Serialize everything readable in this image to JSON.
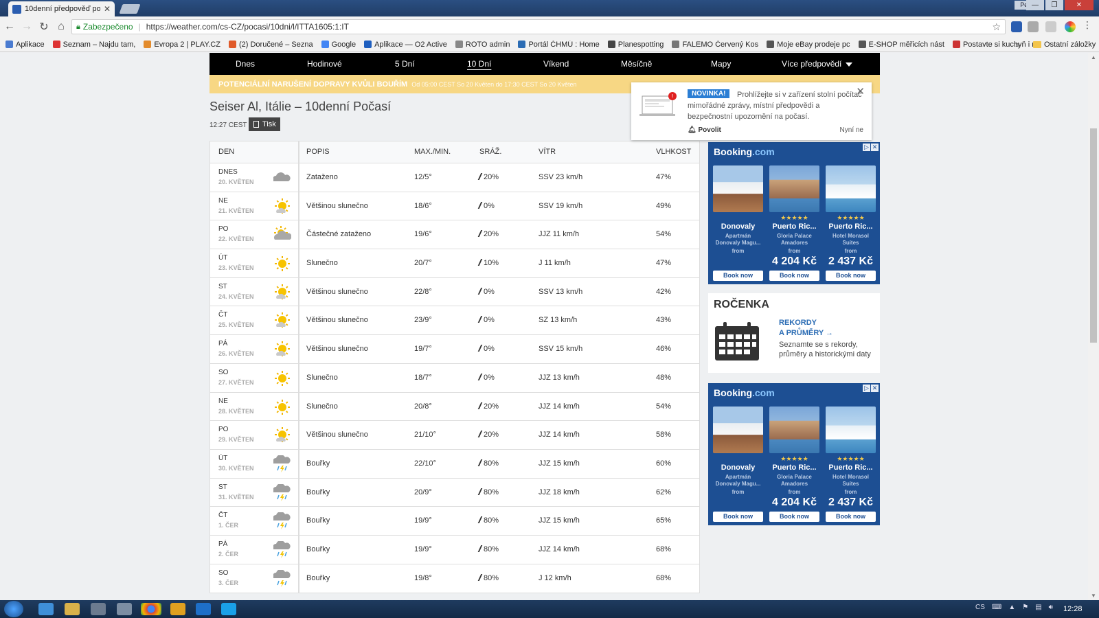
{
  "browser": {
    "tab_title": "10denní předpověď poč",
    "secure_label": "Zabezpečeno",
    "url": "https://weather.com/cs-CZ/pocasi/10dni/l/ITTA1605:1:IT",
    "user_label": "Petr",
    "bookmarks": [
      {
        "label": "Aplikace",
        "color": "#4a7bd0"
      },
      {
        "label": "Seznam – Najdu tam,",
        "color": "#d33"
      },
      {
        "label": "Evropa 2 | PLAY.CZ",
        "color": "#e38b2c"
      },
      {
        "label": "(2) Doručené – Sezna",
        "color": "#e05a2a"
      },
      {
        "label": "Google",
        "color": "#4285f4"
      },
      {
        "label": "Aplikace — O2 Active",
        "color": "#1f5fbf"
      },
      {
        "label": "ROTO admin",
        "color": "#888"
      },
      {
        "label": "Portál ČHMÚ : Home",
        "color": "#2b6cb4"
      },
      {
        "label": "Planespotting",
        "color": "#444"
      },
      {
        "label": "FALEMO Červený Kos",
        "color": "#777"
      },
      {
        "label": "Moje eBay prodeje pc",
        "color": "#555"
      },
      {
        "label": "E-SHOP měřicích nást",
        "color": "#555"
      },
      {
        "label": "Postavte si kuchyň i n",
        "color": "#c33"
      }
    ],
    "bookmarks_more": "»",
    "other_bookmarks": "Ostatní záložky"
  },
  "nav": {
    "items": [
      "Dnes",
      "Hodinové",
      "5 Dní",
      "10 Dní",
      "Víkend",
      "Měsíčně",
      "Mapy",
      "Více předpovědí"
    ]
  },
  "alert": {
    "title": "POTENCIÁLNÍ NARUŠENÍ DOPRAVY KVŮLI BOUŘÍM",
    "subtitle": "Od 05:00 CEST So 20 Květen do 17:30 CEST So 20 Květen"
  },
  "page": {
    "title": "Seiser Al, Itálie – 10denní Počasí",
    "time": "12:27 CEST",
    "print_label": "Tisk"
  },
  "table": {
    "headers": [
      "DEN",
      "POPIS",
      "MAX./MIN.",
      "SRÁŽ.",
      "VÍTR",
      "VLHKOST"
    ],
    "rows": [
      {
        "day": "DNES",
        "date": "20. KVĚTEN",
        "icon": "cloudy-icon",
        "desc": "Zataženo",
        "temp": "12/5°",
        "precip": "20%",
        "wind": "SSV 23 km/h",
        "humidity": "47%"
      },
      {
        "day": "NE",
        "date": "21. KVĚTEN",
        "icon": "mostly-sunny-icon",
        "desc": "Většinou slunečno",
        "temp": "18/6°",
        "precip": "0%",
        "wind": "SSV 19 km/h",
        "humidity": "49%"
      },
      {
        "day": "PO",
        "date": "22. KVĚTEN",
        "icon": "partly-cloudy-icon",
        "desc": "Částečné zataženo",
        "temp": "19/6°",
        "precip": "20%",
        "wind": "JJZ 11 km/h",
        "humidity": "54%"
      },
      {
        "day": "ÚT",
        "date": "23. KVĚTEN",
        "icon": "sunny-icon",
        "desc": "Slunečno",
        "temp": "20/7°",
        "precip": "10%",
        "wind": "J 11 km/h",
        "humidity": "47%"
      },
      {
        "day": "ST",
        "date": "24. KVĚTEN",
        "icon": "mostly-sunny-icon",
        "desc": "Většinou slunečno",
        "temp": "22/8°",
        "precip": "0%",
        "wind": "SSV 13 km/h",
        "humidity": "42%"
      },
      {
        "day": "ČT",
        "date": "25. KVĚTEN",
        "icon": "mostly-sunny-icon",
        "desc": "Většinou slunečno",
        "temp": "23/9°",
        "precip": "0%",
        "wind": "SZ 13 km/h",
        "humidity": "43%"
      },
      {
        "day": "PÁ",
        "date": "26. KVĚTEN",
        "icon": "mostly-sunny-icon",
        "desc": "Většinou slunečno",
        "temp": "19/7°",
        "precip": "0%",
        "wind": "SSV 15 km/h",
        "humidity": "46%"
      },
      {
        "day": "SO",
        "date": "27. KVĚTEN",
        "icon": "sunny-icon",
        "desc": "Slunečno",
        "temp": "18/7°",
        "precip": "0%",
        "wind": "JJZ 13 km/h",
        "humidity": "48%"
      },
      {
        "day": "NE",
        "date": "28. KVĚTEN",
        "icon": "sunny-icon",
        "desc": "Slunečno",
        "temp": "20/8°",
        "precip": "20%",
        "wind": "JJZ 14 km/h",
        "humidity": "54%"
      },
      {
        "day": "PO",
        "date": "29. KVĚTEN",
        "icon": "mostly-sunny-icon",
        "desc": "Většinou slunečno",
        "temp": "21/10°",
        "precip": "20%",
        "wind": "JJZ 14 km/h",
        "humidity": "58%"
      },
      {
        "day": "ÚT",
        "date": "30. KVĚTEN",
        "icon": "thunderstorm-icon",
        "desc": "Bouřky",
        "temp": "22/10°",
        "precip": "80%",
        "wind": "JJZ 15 km/h",
        "humidity": "60%"
      },
      {
        "day": "ST",
        "date": "31. KVĚTEN",
        "icon": "thunderstorm-icon",
        "desc": "Bouřky",
        "temp": "20/9°",
        "precip": "80%",
        "wind": "JJZ 18 km/h",
        "humidity": "62%"
      },
      {
        "day": "ČT",
        "date": "1. ČER",
        "icon": "thunderstorm-icon",
        "desc": "Bouřky",
        "temp": "19/9°",
        "precip": "80%",
        "wind": "JJZ 15 km/h",
        "humidity": "65%"
      },
      {
        "day": "PÁ",
        "date": "2. ČER",
        "icon": "thunderstorm-icon",
        "desc": "Bouřky",
        "temp": "19/9°",
        "precip": "80%",
        "wind": "JJZ 14 km/h",
        "humidity": "68%"
      },
      {
        "day": "SO",
        "date": "3. ČER",
        "icon": "thunderstorm-icon",
        "desc": "Bouřky",
        "temp": "19/8°",
        "precip": "80%",
        "wind": "J 12 km/h",
        "humidity": "68%"
      }
    ]
  },
  "popup": {
    "badge": "NOVINKA!",
    "text": "Prohlížejte si v zařízení stolní počítač mimořádné zprávy, místní předpovědi a bezpečnostní upozornění na počasí.",
    "allow": "Povolit",
    "later": "Nyní ne"
  },
  "booking_ad": {
    "logo": "Booking",
    "logo_suffix": ".com",
    "hotels": [
      {
        "name": "Donovaly",
        "sub": "Apartmán Donovaly Magu...",
        "from": "from",
        "price": "",
        "stars": "",
        "button": "Book now"
      },
      {
        "name": "Puerto Ric...",
        "sub": "Gloria Palace Amadores",
        "from": "from",
        "price": "4 204 Kč",
        "stars": "★★★★★",
        "button": "Book now"
      },
      {
        "name": "Puerto Ric...",
        "sub": "Hotel Morasol Suites",
        "from": "from",
        "price": "2 437 Kč",
        "stars": "★★★★★",
        "button": "Book now"
      }
    ]
  },
  "rocenka": {
    "title": "ROČENKA",
    "link_line1": "REKORDY",
    "link_line2": "A PRŮMĚRY →",
    "desc": "Seznamte se s rekordy, průměry a historickými daty"
  },
  "taskbar": {
    "tray_lang": "CS",
    "clock": "12:28"
  }
}
